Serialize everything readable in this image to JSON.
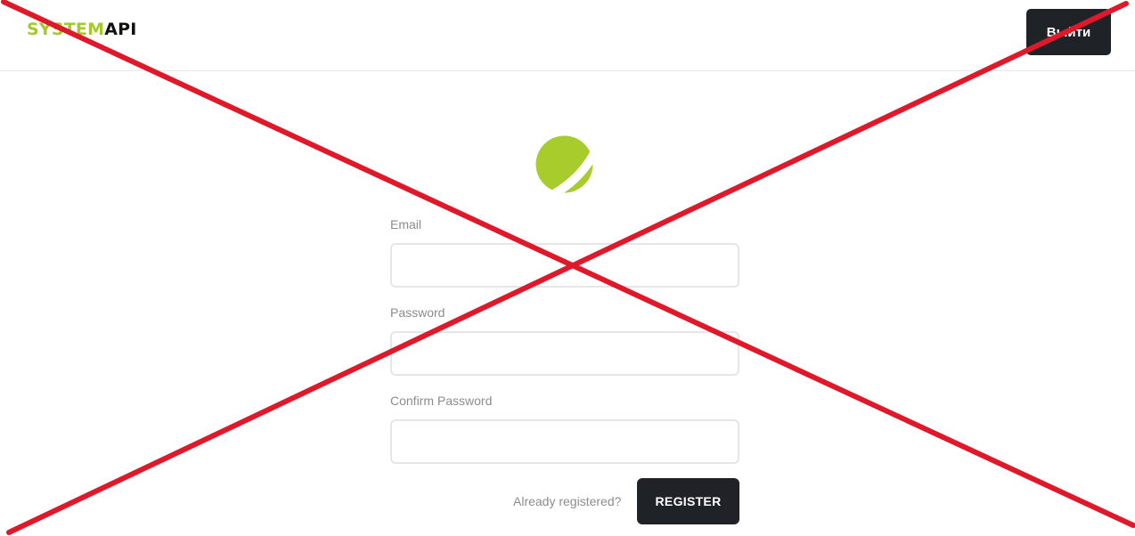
{
  "header": {
    "brand_part1": "SYSTEM",
    "brand_part2": "API",
    "logout_label": "Выйти"
  },
  "form": {
    "email_label": "Email",
    "email_value": "",
    "password_label": "Password",
    "password_value": "",
    "confirm_label": "Confirm Password",
    "confirm_value": "",
    "already_registered": "Already registered?",
    "register_label": "REGISTER"
  },
  "colors": {
    "brand_green": "#a4c92a",
    "button_dark": "#1f2328",
    "label_gray": "#8c8c8c",
    "cross_red": "#e0192a"
  },
  "icons": {
    "logo": "green-sphere-logo-icon",
    "overlay": "red-x-cross-icon"
  }
}
